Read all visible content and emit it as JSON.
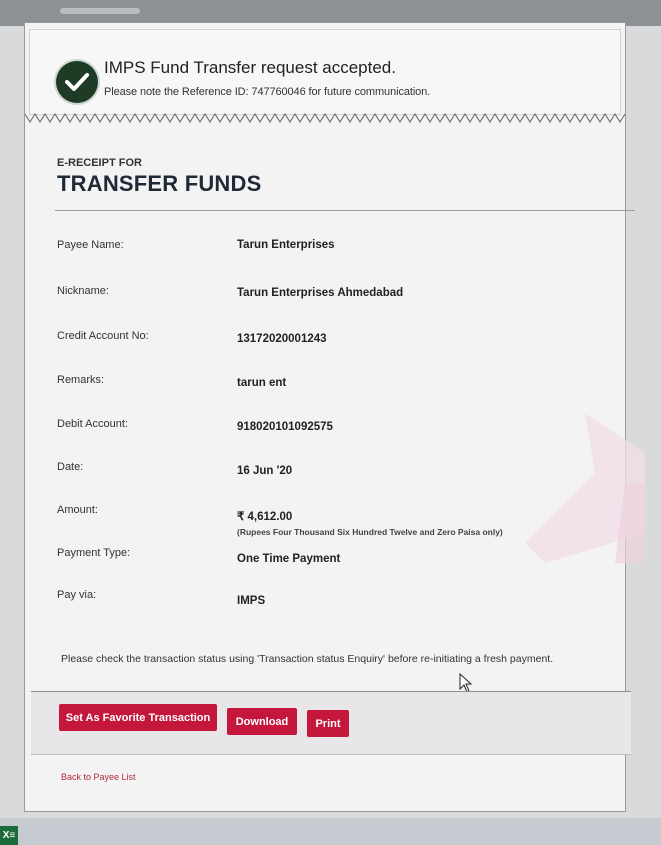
{
  "banner": {
    "title": "IMPS Fund Transfer request accepted.",
    "subtitle": "Please note the Reference ID: 747760046 for future communication."
  },
  "receipt": {
    "label": "E-RECEIPT FOR",
    "title": "TRANSFER FUNDS",
    "fields": [
      {
        "label": "Payee Name:",
        "value": "Tarun Enterprises"
      },
      {
        "label": "Nickname:",
        "value": "Tarun Enterprises Ahmedabad"
      },
      {
        "label": "Credit Account No:",
        "value": "13172020001243"
      },
      {
        "label": "Remarks:",
        "value": "tarun ent"
      },
      {
        "label": "Debit Account:",
        "value": "918020101092575"
      },
      {
        "label": "Date:",
        "value": "16 Jun '20"
      },
      {
        "label": "Amount:",
        "value": "₹ 4,612.00",
        "note": "(Rupees Four Thousand Six Hundred Twelve and Zero Paisa only)"
      },
      {
        "label": "Payment Type:",
        "value": "One Time Payment"
      },
      {
        "label": "Pay via:",
        "value": "IMPS"
      }
    ],
    "footnote": "Please check the transaction status using 'Transaction status Enquiry' before re-initiating a fresh payment."
  },
  "actions": {
    "favorite": "Set As Favorite Transaction",
    "download": "Download",
    "print": "Print"
  },
  "links": {
    "back": "Back to Payee List"
  },
  "taskbar": {
    "app_icon_text": "X≡"
  },
  "colors": {
    "accent": "#c5173b",
    "check_bg": "#1e3b26"
  },
  "icons": {
    "status": "checkmark-icon",
    "watermark": "bank-logo-watermark",
    "cursor": "mouse-pointer-icon"
  }
}
